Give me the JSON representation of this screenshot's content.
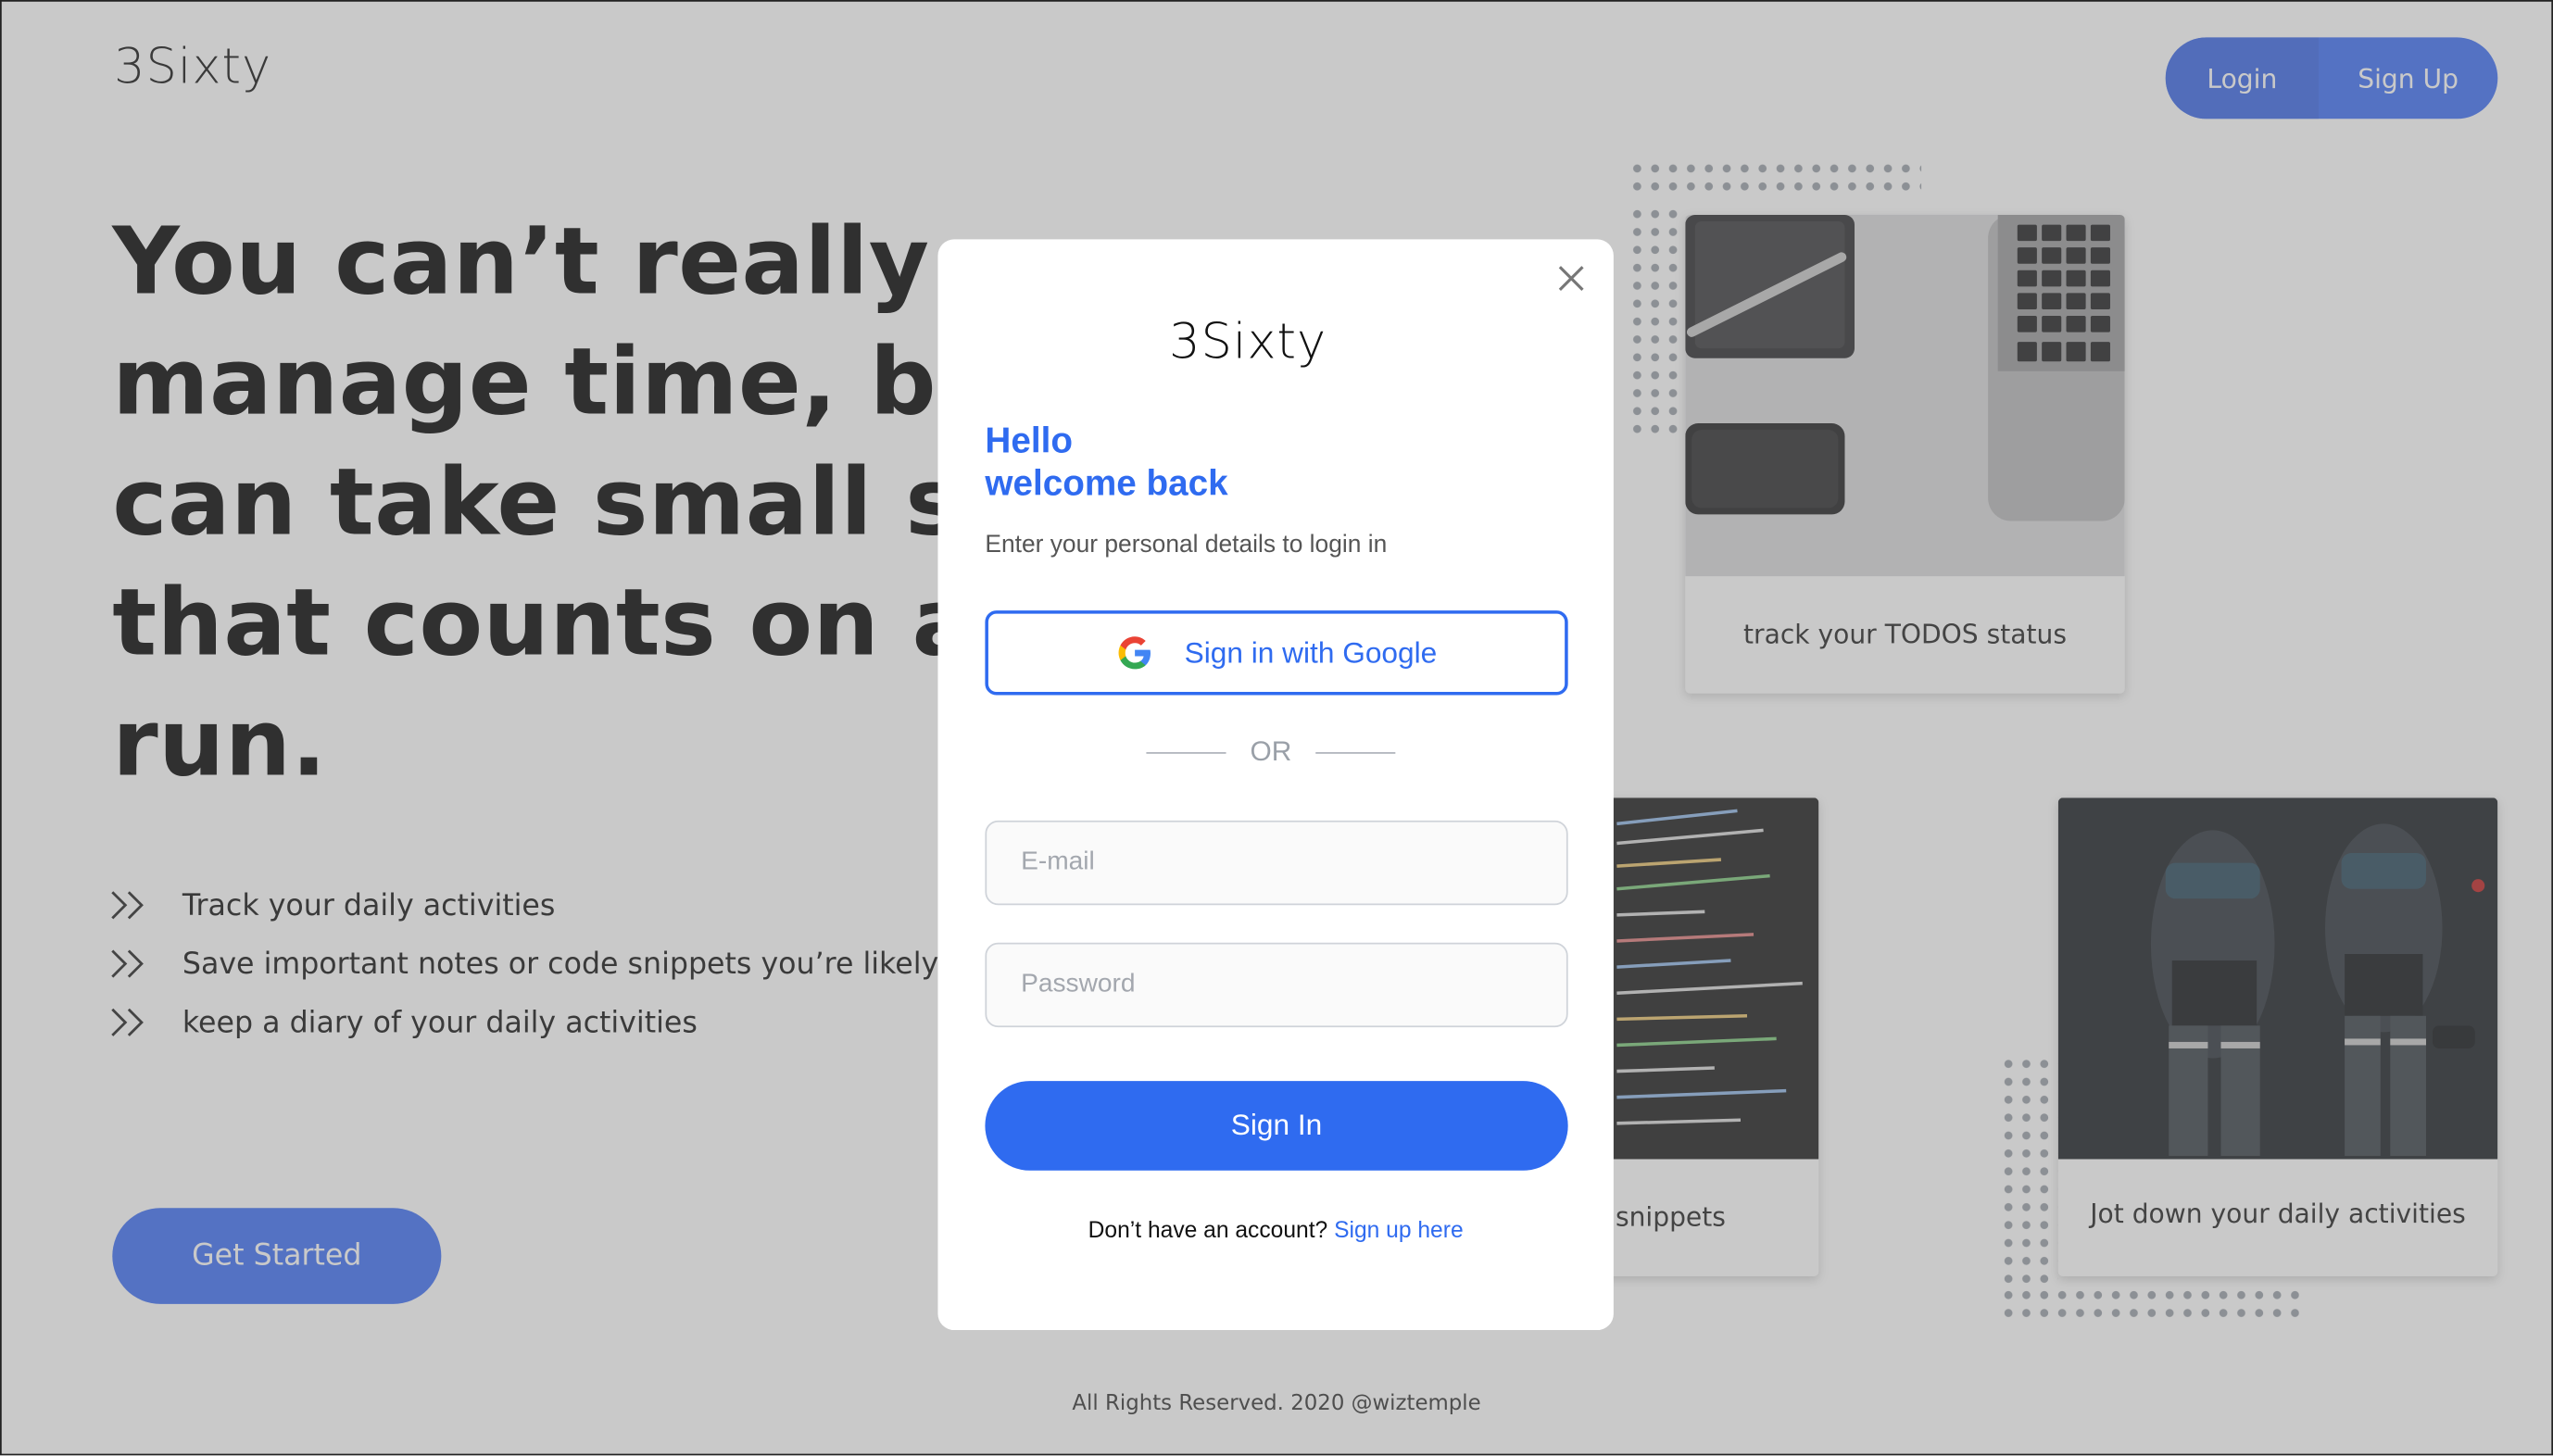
{
  "brand": {
    "logo_text": "3Sixty"
  },
  "header": {
    "login_label": "Login",
    "signup_label": "Sign Up"
  },
  "hero": {
    "lines": [
      "You can’t really",
      "manage time, but you",
      "can take small steps",
      "that counts on a long",
      "run."
    ]
  },
  "features": [
    {
      "icon": "double-chevron-right-icon",
      "text": "Track your daily activities"
    },
    {
      "icon": "double-chevron-right-icon",
      "text": "Save important notes or code snippets you’re likely to need"
    },
    {
      "icon": "double-chevron-right-icon",
      "text": "keep a diary of your daily activities"
    }
  ],
  "cta": {
    "get_started_label": "Get Started"
  },
  "cards": [
    {
      "caption": "track your TODOS status",
      "image": "desk-laptop-phone-photo"
    },
    {
      "caption": "Save code snippets",
      "image": "code-screen-photo"
    },
    {
      "caption": "Jot down your daily activities",
      "image": "fitness-photo"
    }
  ],
  "footer": {
    "text": "All Rights Reserved. 2020 @wiztemple"
  },
  "modal": {
    "logo_text": "3Sixty",
    "greeting_line1": "Hello",
    "greeting_line2": "welcome back",
    "subtitle": "Enter your personal details to login in",
    "google_label": "Sign in with Google",
    "divider_text": "OR",
    "email_placeholder": "E-mail",
    "password_placeholder": "Password",
    "signin_label": "Sign In",
    "no_account_text": "Don’t have an account?",
    "signup_link": "Sign up here",
    "close_icon": "close-icon"
  },
  "colors": {
    "accent": "#2f6bf0",
    "button": "#3d6ef5",
    "overlay": "#c8c8c8"
  }
}
